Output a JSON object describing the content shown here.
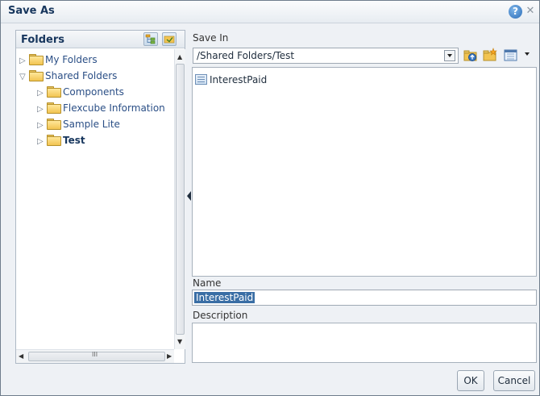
{
  "dialog": {
    "title": "Save As"
  },
  "folders_pane": {
    "title": "Folders",
    "tree": [
      {
        "label": "My Folders",
        "level": 0,
        "expanded": false
      },
      {
        "label": "Shared Folders",
        "level": 0,
        "expanded": true
      },
      {
        "label": "Components",
        "level": 1,
        "expanded": false
      },
      {
        "label": "Flexcube Information",
        "level": 1,
        "expanded": false
      },
      {
        "label": "Sample Lite",
        "level": 1,
        "expanded": false
      },
      {
        "label": "Test",
        "level": 1,
        "expanded": false,
        "selected": true
      }
    ],
    "hscroll_grip": "III"
  },
  "save_in": {
    "label": "Save In",
    "path": "/Shared Folders/Test"
  },
  "file_list": {
    "items": [
      {
        "label": "InterestPaid",
        "icon": "analysis-icon"
      }
    ]
  },
  "name_field": {
    "label": "Name",
    "value": "InterestPaid"
  },
  "description_field": {
    "label": "Description",
    "value": ""
  },
  "buttons": {
    "ok": "OK",
    "cancel": "Cancel"
  },
  "icons": {
    "help": "help-icon",
    "close": "close-icon",
    "tree_view": "folder-tree-icon",
    "collapse": "folder-collapse-icon",
    "up_folder": "up-folder-icon",
    "new_folder": "new-folder-icon",
    "view_mode": "view-mode-icon"
  },
  "colors": {
    "title_text": "#17365d",
    "selection": "#3a6ea5",
    "folder": "#f2c451"
  }
}
